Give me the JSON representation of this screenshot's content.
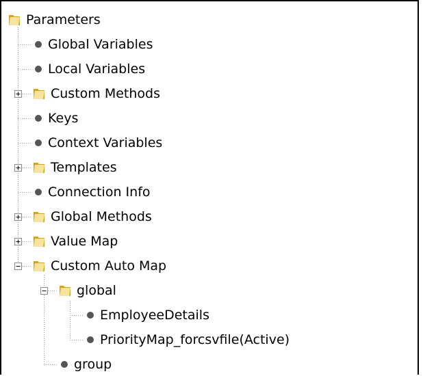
{
  "tree": {
    "root": {
      "label": "Parameters",
      "icon": "folder-icon"
    },
    "items": [
      {
        "label": "Global Variables",
        "icon": "bullet-icon"
      },
      {
        "label": "Local Variables",
        "icon": "bullet-icon"
      },
      {
        "label": "Custom Methods",
        "icon": "folder-icon",
        "expander": "+"
      },
      {
        "label": "Keys",
        "icon": "bullet-icon"
      },
      {
        "label": "Context Variables",
        "icon": "bullet-icon"
      },
      {
        "label": "Templates",
        "icon": "folder-icon",
        "expander": "+"
      },
      {
        "label": "Connection Info",
        "icon": "bullet-icon"
      },
      {
        "label": "Global Methods",
        "icon": "folder-icon",
        "expander": "+"
      },
      {
        "label": "Value Map",
        "icon": "folder-icon",
        "expander": "+"
      },
      {
        "label": "Custom Auto Map",
        "icon": "folder-icon",
        "expander": "-"
      }
    ],
    "custom_auto_map_children": [
      {
        "label": "global",
        "icon": "folder-icon",
        "expander": "-"
      },
      {
        "label": "group",
        "icon": "bullet-icon"
      }
    ],
    "global_children": [
      {
        "label": "EmployeeDetails",
        "icon": "bullet-icon"
      },
      {
        "label": "PriorityMap_forcsvfile(Active)",
        "icon": "bullet-icon"
      }
    ]
  },
  "colors": {
    "folder_light": "#f7e39a",
    "folder_dark": "#d9a21b",
    "bullet": "#555555",
    "connector": "#9a9a9a"
  }
}
